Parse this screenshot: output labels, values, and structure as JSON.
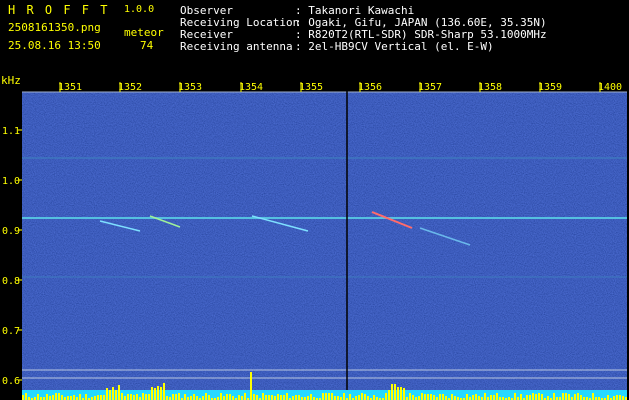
{
  "app": {
    "name": "H R O F F T",
    "version": "1.0.0",
    "filename": "2508161350.png",
    "datetime": "25.08.16 13:50",
    "meteor_label": "meteor",
    "meteor_count": "74"
  },
  "station": {
    "labels": {
      "observer": "Observer",
      "location": "Receiving Location",
      "receiver": "Receiver",
      "antenna": "Receiving antenna"
    },
    "values": {
      "observer": ": Takanori Kawachi",
      "location": ": Ogaki, Gifu, JAPAN (136.60E, 35.35N)",
      "receiver": ": R820T2(RTL-SDR) SDR-Sharp 53.1000MHz",
      "antenna": ": 2el-HB9CV Vertical (el. E-W)"
    }
  },
  "axis": {
    "unit": "kHz",
    "time_ticks": [
      "1351",
      "1352",
      "1353",
      "1354",
      "1355",
      "1356",
      "1357",
      "1358",
      "1359",
      "1400"
    ],
    "freq_ticks": [
      "1.1",
      "1.0",
      "0.9",
      "0.8",
      "0.7",
      "0.6"
    ]
  },
  "colors": {
    "text_yellow": "#ffff00",
    "background": "#000000",
    "spectrogram_base": "#1c2f9a",
    "carrier_line": "#4fb3d8",
    "histogram_base": "#28d8ff",
    "histogram_bars": "#ffff00"
  }
}
